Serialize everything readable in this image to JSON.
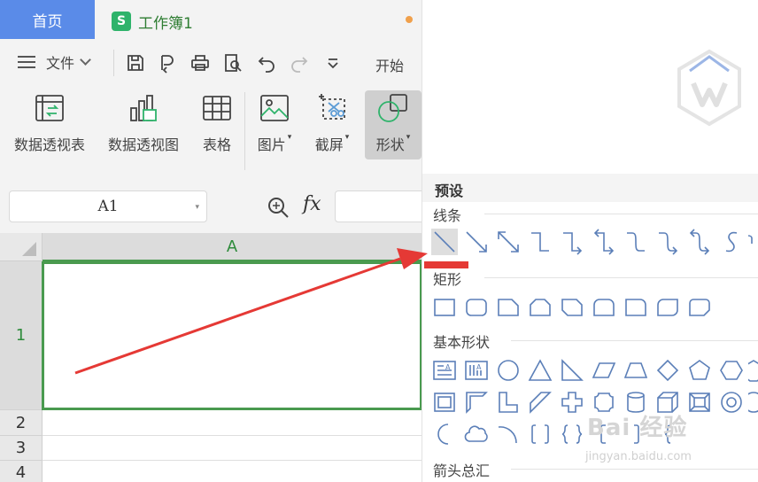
{
  "tabs": {
    "home": "首页",
    "document": "工作簿1",
    "sheet_logo": "S"
  },
  "quickbar": {
    "file_menu": "文件",
    "start_tab": "开始"
  },
  "ribbon": {
    "pivot_table": "数据透视表",
    "pivot_chart": "数据透视图",
    "table": "表格",
    "picture": "图片",
    "screenshot": "截屏",
    "shape": "形状"
  },
  "formula_bar": {
    "name_box": "A1",
    "fx": "fx",
    "formula": ""
  },
  "grid": {
    "column_a": "A",
    "rows": [
      "1",
      "2",
      "3",
      "4"
    ],
    "selected_cell": "A1"
  },
  "shape_panel": {
    "header": "预设",
    "sections": {
      "lines": "线条",
      "rectangles": "矩形",
      "basic_shapes": "基本形状",
      "block_arrows": "箭头总汇"
    }
  },
  "watermark": {
    "brand": "Bai 经验",
    "url": "jingyan.baidu.com"
  },
  "colors": {
    "accent_blue": "#5a8be8",
    "sheet_green": "#2fb36b",
    "selection_green": "#4a9a4f",
    "shape_blue": "#5b7fb8",
    "annotation_red": "#e53935"
  }
}
